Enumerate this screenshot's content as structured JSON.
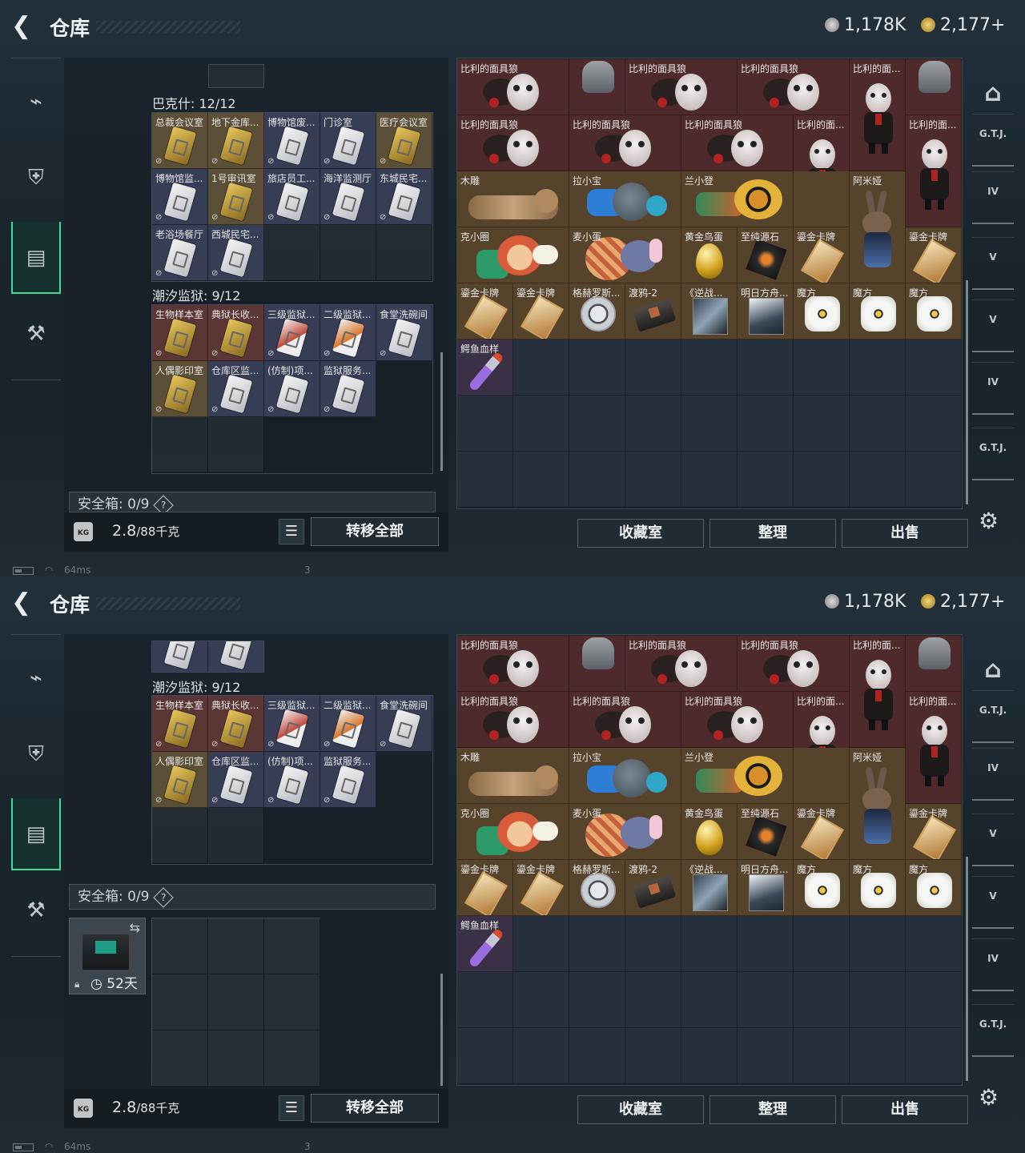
{
  "app": {
    "title": "仓库"
  },
  "currency": {
    "silver": "1,178K",
    "gold": "2,177+"
  },
  "status": {
    "ping": "64ms",
    "page_num": "3"
  },
  "groups": {
    "bakesh": {
      "title": "巴克什: 12/12",
      "cards": [
        {
          "label": "总裁会议室",
          "color": "gold"
        },
        {
          "label": "地下金库...",
          "color": "gold"
        },
        {
          "label": "博物馆废...",
          "color": "blue"
        },
        {
          "label": "门诊室",
          "color": "blue"
        },
        {
          "label": "医疗会议室",
          "color": "gold"
        },
        {
          "label": "博物馆监...",
          "color": "blue"
        },
        {
          "label": "1号审讯室",
          "color": "gold"
        },
        {
          "label": "旅店员工...",
          "color": "blue"
        },
        {
          "label": "海洋监测厅",
          "color": "blue"
        },
        {
          "label": "东城民宅...",
          "color": "blue"
        },
        {
          "label": "老浴场餐厅",
          "color": "blue"
        },
        {
          "label": "西城民宅...",
          "color": "blue"
        }
      ]
    },
    "chaoxi": {
      "title": "潮汐监狱: 9/12",
      "cards": [
        {
          "label": "生物样本室",
          "color": "red"
        },
        {
          "label": "典狱长收...",
          "color": "red"
        },
        {
          "label": "三级监狱...",
          "color": "blue"
        },
        {
          "label": "二级监狱...",
          "color": "blue"
        },
        {
          "label": "食堂洗碗间",
          "color": "blue"
        },
        {
          "label": "人偶影印室",
          "color": "gold"
        },
        {
          "label": "仓库区监...",
          "color": "blue"
        },
        {
          "label": "(仿制)项...",
          "color": "blue"
        },
        {
          "label": "监狱服务...",
          "color": "blue"
        }
      ]
    }
  },
  "safe_box": {
    "label": "安全箱: 0/9",
    "help": "?",
    "days": "52天"
  },
  "footer": {
    "weight_main": "2.8",
    "weight_total": "/88千克",
    "transfer_all": "转移全部",
    "collection": "收藏室",
    "sort": "整理",
    "sell": "出售",
    "kg_icon": "KG"
  },
  "warehouse_labels": {
    "jigsaw": "比利的面具狼",
    "jigsaw_short": "比利的面...",
    "mudiao": "木雕",
    "laxiaobao": "拉小宝",
    "lanxiaodeng": "兰小登",
    "amiya": "阿米娅",
    "kexiaoquan": "克小圈",
    "maixiaodan": "麦小蛋",
    "golden_egg": "黄金鸟蛋",
    "pure_stone": "至纯源石",
    "gold_card": "鎏金卡牌",
    "gehelos": "格赫罗斯...",
    "crow": "渡鸦-2",
    "nizhan": "《逆战...",
    "mingri": "明日方舟...",
    "mofang": "魔方",
    "crocodile": "鳄鱼血样"
  },
  "rightbar": {
    "gtj": "G.T.J.",
    "iv": "IV",
    "v": "V"
  }
}
